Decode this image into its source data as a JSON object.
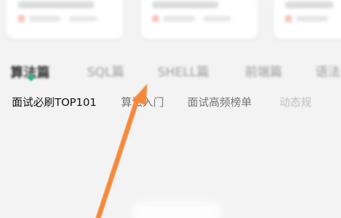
{
  "category_tabs": [
    {
      "label": "算法篇",
      "active": true
    },
    {
      "label": "SQL篇",
      "active": false
    },
    {
      "label": "SHELL篇",
      "active": false
    },
    {
      "label": "前端篇",
      "active": false
    },
    {
      "label": "语法",
      "active": false
    }
  ],
  "sub_tabs": [
    {
      "label": "面试必刷TOP101",
      "active": true
    },
    {
      "label": "算法入门",
      "active": false
    },
    {
      "label": "面试高频榜单",
      "active": false
    },
    {
      "label": "动态规",
      "active": false
    }
  ],
  "colors": {
    "accent": "#2db37a",
    "annotation_arrow": "#f5893a",
    "background": "#f3f3f4"
  },
  "annotation": {
    "icon": "arrow-annotation-icon"
  }
}
